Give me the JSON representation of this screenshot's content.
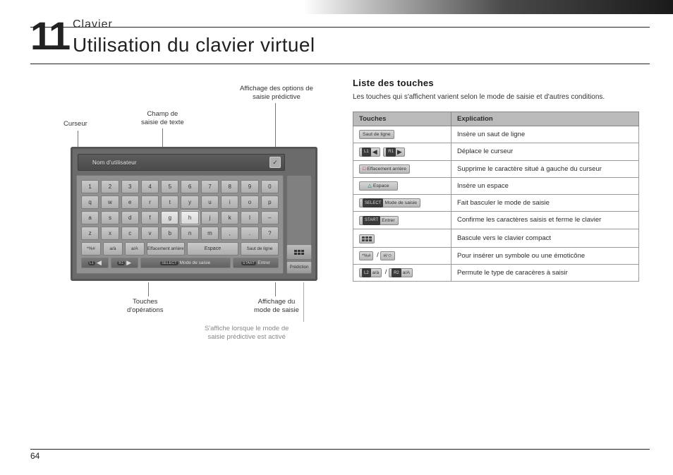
{
  "section_number": "11",
  "section_label": "Clavier",
  "section_title": "Utilisation du clavier virtuel",
  "page_number": "64",
  "diagram": {
    "callouts": {
      "cursor": "Curseur",
      "text_field": "Champ de\nsaisie de texte",
      "predictive_opts": "Affichage des options de\nsaisie prédictive",
      "op_keys": "Touches\nd'opérations",
      "mode_display": "Affichage du\nmode de saisie",
      "predictive_hint": "S'affiche lorsque le mode de\nsaisie prédictive est activé"
    },
    "keyboard": {
      "field_label": "Nom d'utilisateur",
      "option_btn": "✓",
      "rows": {
        "r1": [
          "1",
          "2",
          "3",
          "4",
          "5",
          "6",
          "7",
          "8",
          "9",
          "0"
        ],
        "r2": [
          "q",
          "w",
          "e",
          "r",
          "t",
          "y",
          "u",
          "i",
          "o",
          "p"
        ],
        "r3": [
          "a",
          "s",
          "d",
          "f",
          "g",
          "h",
          "j",
          "k",
          "l",
          "–"
        ],
        "r4": [
          "z",
          "x",
          "c",
          "v",
          "b",
          "n",
          "m",
          ",",
          ".",
          "?"
        ]
      },
      "ops": {
        "sym": "*%#",
        "accent": "a/à",
        "case": "a/A",
        "backspace": "Effacement\narrière",
        "space": "Espace",
        "newline": "Saut de ligne"
      },
      "bottom": {
        "left_arrow": "◀",
        "right_arrow": "▶",
        "mode": "Mode de saisie",
        "enter": "Entrer",
        "select_badge": "SELECT",
        "start_badge": "START",
        "l1_badge": "L1",
        "r1_badge": "R1",
        "prediction": "Prédiction"
      }
    }
  },
  "list_heading": "Liste des touches",
  "list_intro": "Les touches qui s'affichent varient selon le mode de saisie et d'autres conditions.",
  "table": {
    "headers": {
      "keys": "Touches",
      "explanation": "Explication"
    },
    "rows": [
      {
        "key_labels": [
          "Saut de ligne"
        ],
        "desc": "Insère un saut de ligne"
      },
      {
        "key_labels": [
          "L1",
          "R1",
          "◀",
          "▶"
        ],
        "variant": "arrows",
        "desc": "Déplace le curseur"
      },
      {
        "key_labels": [
          "□",
          "Effacement arrière"
        ],
        "variant": "backspace",
        "desc": "Supprime le caractère situé à gauche du curseur"
      },
      {
        "key_labels": [
          "△",
          "Espace"
        ],
        "variant": "space",
        "desc": "Insère un espace"
      },
      {
        "key_labels": [
          "SELECT",
          "Mode de saisie"
        ],
        "variant": "mode",
        "desc": "Fait basculer le mode de saisie"
      },
      {
        "key_labels": [
          "START",
          "Entrer"
        ],
        "variant": "enter",
        "desc": "Confirme les caractères saisis et ferme le clavier"
      },
      {
        "key_labels": [
          "grid-icon"
        ],
        "variant": "grid",
        "desc": "Bascule vers le clavier compact"
      },
      {
        "key_labels": [
          "*%#",
          "/",
          "#/☺"
        ],
        "variant": "symbols",
        "desc": "Pour insérer un symbole ou une émoticône"
      },
      {
        "key_labels": [
          "L2",
          "a/à",
          "/",
          "R2",
          "a/A"
        ],
        "variant": "chartype",
        "desc": "Permute le type de caracères à saisir"
      }
    ]
  }
}
